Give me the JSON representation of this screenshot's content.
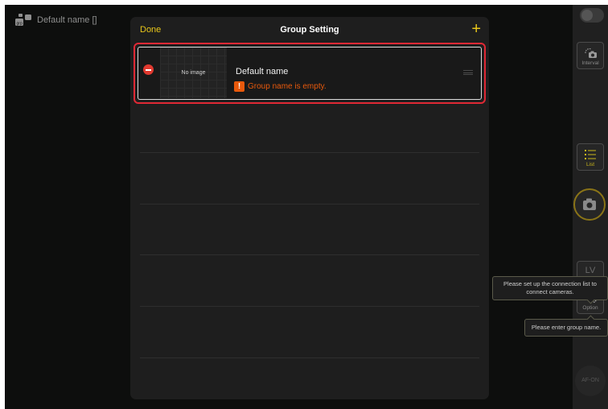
{
  "top_bar": {
    "group_label": "Default name []",
    "group_icon": "camera-group-icon"
  },
  "modal": {
    "done_label": "Done",
    "title": "Group Setting",
    "add_label": "+",
    "group": {
      "thumbnail_text": "No image",
      "name": "Default name",
      "error_icon": "!",
      "error_text": "Group name is empty."
    }
  },
  "right_panel": {
    "interval_label": "Interval",
    "list_label": "List",
    "lv_label": "LV",
    "option_label": "Option",
    "af_on_label": "AF-ON"
  },
  "tooltips": {
    "connection_text": "Please set up the connection list to connect cameras.",
    "group_name_text": "Please enter group name."
  },
  "colors": {
    "accent": "#e8c61a",
    "error": "#e8590c",
    "highlight_border": "#e02935"
  }
}
